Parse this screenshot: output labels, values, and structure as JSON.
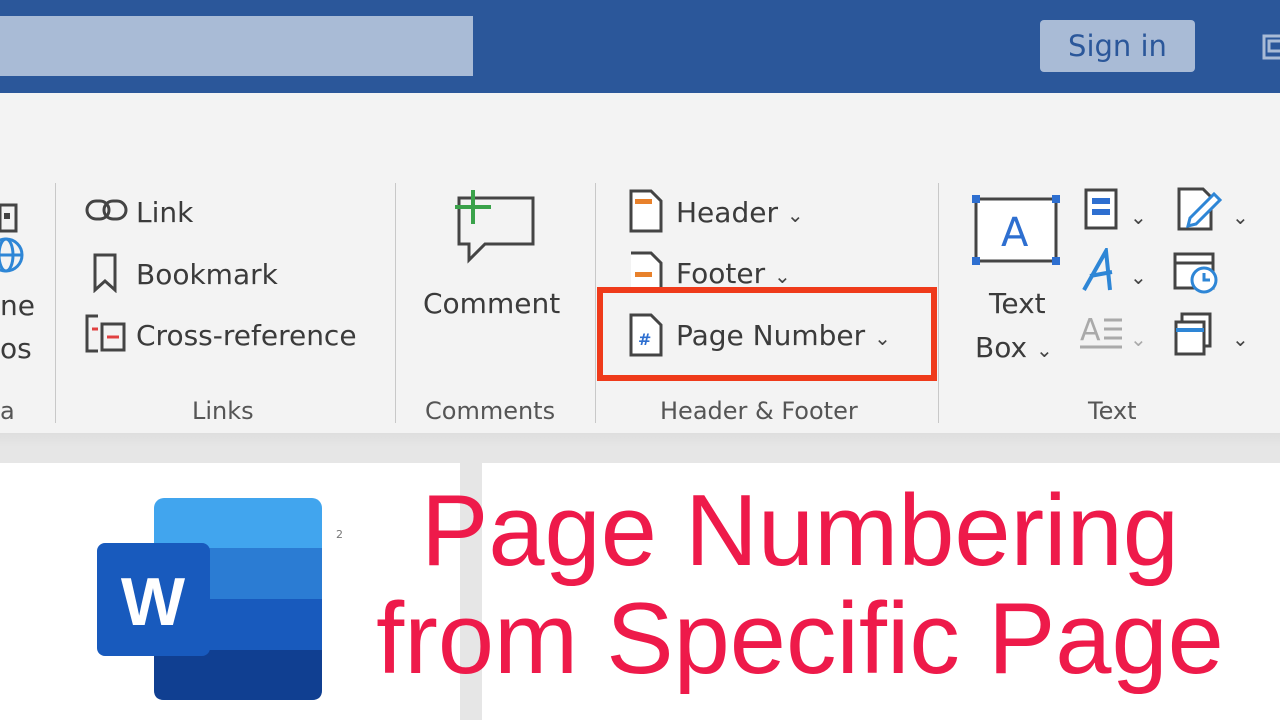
{
  "titlebar": {
    "sign_in_label": "Sign in",
    "search_value": ""
  },
  "ribbon": {
    "partial_group": {
      "text_1": "ne",
      "text_2": "os",
      "group_label": "a"
    },
    "links": {
      "items": [
        "Link",
        "Bookmark",
        "Cross-reference"
      ],
      "group_label": "Links"
    },
    "comments": {
      "button_label": "Comment",
      "group_label": "Comments"
    },
    "header_footer": {
      "header_label": "Header",
      "footer_label": "Footer",
      "page_number_label": "Page Number",
      "group_label": "Header & Footer"
    },
    "text": {
      "text_box_line1": "Text",
      "text_box_line2": "Box",
      "group_label": "Text"
    }
  },
  "document": {
    "page_marker": "2"
  },
  "overlay": {
    "headline_line1": "Page Numbering",
    "headline_line2": "from Specific Page",
    "headline_color": "#ee1a4a",
    "highlight_color": "#ef3a1a"
  },
  "colors": {
    "titlebar": "#2b579a",
    "ribbon": "#f3f3f3",
    "word_logo_dark": "#185abd"
  },
  "icons": [
    "link-icon",
    "bookmark-icon",
    "cross-reference-icon",
    "comment-icon",
    "header-icon",
    "footer-icon",
    "page-number-icon",
    "text-box-icon",
    "quick-parts-icon",
    "wordart-icon",
    "drop-cap-icon",
    "signature-line-icon",
    "date-time-icon",
    "object-icon",
    "word-logo-icon"
  ]
}
